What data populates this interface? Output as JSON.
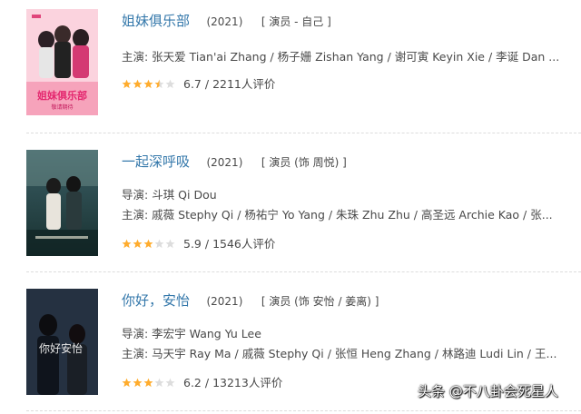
{
  "items": [
    {
      "title": "姐妹俱乐部",
      "year": "(2021)",
      "role": "[ 演员 - 自己 ]",
      "director": null,
      "cast": "主演: 张天爱 Tian'ai Zhang / 杨子姗 Zishan Yang / 谢可寅 Keyin Xie / 李诞 Dan ...",
      "score": "6.7",
      "count": "2211人评价",
      "stars": 3.5,
      "poster_text": "姐妹俱乐部",
      "poster_subtext": "敬请期待"
    },
    {
      "title": "一起深呼吸",
      "year": "(2021)",
      "role": "[ 演员 (饰 周悦) ]",
      "director": "导演: 斗琪 Qi Dou",
      "cast": "主演: 戚薇 Stephy Qi / 杨祐宁 Yo Yang / 朱珠 Zhu Zhu / 高圣远 Archie Kao / 张...",
      "score": "5.9",
      "count": "1546人评价",
      "stars": 3
    },
    {
      "title": "你好，安怡",
      "year": "(2021)",
      "role": "[ 演员 (饰 安怡 / 姜离) ]",
      "director": "导演: 李宏宇 Wang Yu Lee",
      "cast": "主演: 马天宇 Ray Ma / 戚薇 Stephy Qi / 张恒 Heng Zhang / 林路迪 Ludi Lin / 王...",
      "score": "6.2",
      "count": "13213人评价",
      "stars": 3,
      "poster_text": "你好安怡"
    }
  ],
  "separator": " / ",
  "watermark": "头条 @不八卦会死星人",
  "colors": {
    "link": "#3377aa",
    "star": "#ffac2d",
    "star_empty": "#dddddd"
  }
}
